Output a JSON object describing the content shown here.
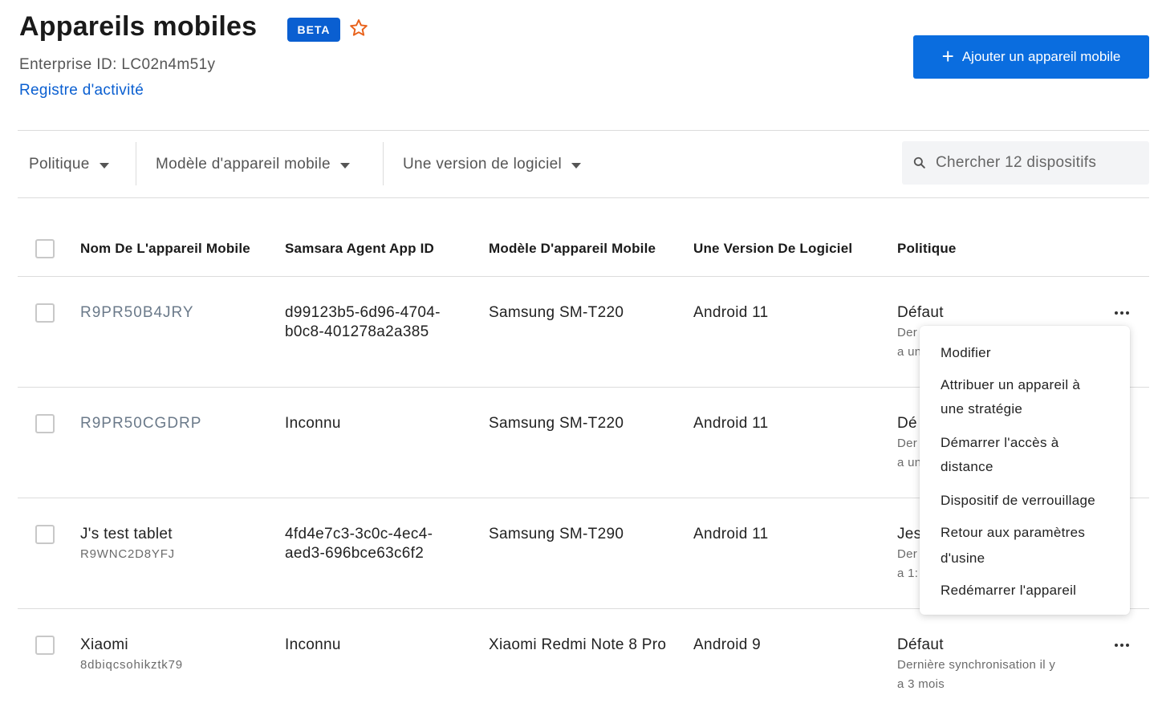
{
  "header": {
    "title": "Appareils mobiles",
    "badge": "BETA",
    "enterprise_id": "Enterprise ID: LC02n4m51y",
    "activity_link": "Registre d'activité",
    "add_button": "Ajouter un appareil mobile"
  },
  "filters": {
    "policy": "Politique",
    "model": "Modèle d'appareil mobile",
    "software": "Une version de logiciel",
    "search_placeholder": "Chercher 12 dispositifs"
  },
  "table": {
    "columns": [
      "Nom De L'appareil Mobile",
      "Samsara Agent App ID",
      "Modèle D'appareil Mobile",
      "Une Version De Logiciel",
      "Politique"
    ],
    "rows": [
      {
        "name": "R9PR50B4JRY",
        "app_id_1": "d99123b5-6d96-4704-",
        "app_id_2": "b0c8-401278a2a385",
        "model": "Samsung SM-T220",
        "software": "Android 11",
        "policy": "Défaut",
        "sync_1": "Der",
        "sync_2": "a un"
      },
      {
        "name": "R9PR50CGDRP",
        "app_id_1": "Inconnu",
        "model": "Samsung SM-T220",
        "software": "Android 11",
        "policy": "Dé",
        "sync_1": "Der",
        "sync_2": "a un"
      },
      {
        "name": "J's test tablet",
        "serial": "R9WNC2D8YFJ",
        "app_id_1": "4fd4e7c3-3c0c-4ec4-",
        "app_id_2": "aed3-696bce63c6f2",
        "model": "Samsung SM-T290",
        "software": "Android 11",
        "policy": "Jes",
        "sync_1": "Der",
        "sync_2": "a 1:"
      },
      {
        "name": "Xiaomi",
        "serial": "8dbiqcsohikztk79",
        "app_id_1": "Inconnu",
        "model": "Xiaomi Redmi Note 8 Pro",
        "software": "Android 9",
        "policy": "Défaut",
        "sync_1": "Dernière synchronisation il y",
        "sync_2": "a 3 mois"
      }
    ]
  },
  "menu": {
    "edit": "Modifier",
    "assign_1": "Attribuer un appareil à",
    "assign_2": "une stratégie",
    "remote_1": "Démarrer l'accès à",
    "remote_2": "distance",
    "lock": "Dispositif de verrouillage",
    "factory_1": "Retour aux paramètres",
    "factory_2": "d'usine",
    "reboot": "Redémarrer l'appareil"
  },
  "colors": {
    "accent": "#0a6ddf",
    "badge": "#0a5fd1",
    "star": "#e8611a",
    "link": "#0a5fd1"
  },
  "icons": [
    "star-icon",
    "plus-icon",
    "caret-down-icon",
    "search-icon",
    "more-icon"
  ]
}
